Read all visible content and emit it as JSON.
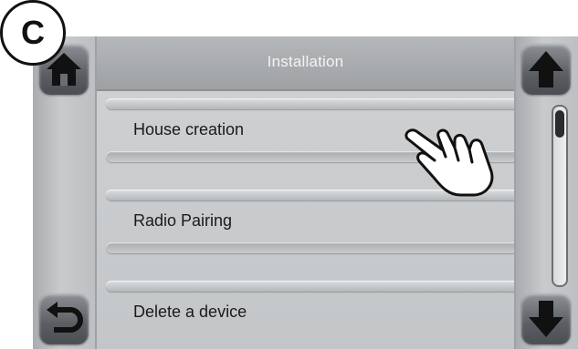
{
  "badge": {
    "label": "C"
  },
  "header": {
    "title": "Installation"
  },
  "menu": {
    "items": [
      {
        "label": "House creation"
      },
      {
        "label": "Radio Pairing"
      },
      {
        "label": "Delete a device"
      }
    ]
  },
  "scroll": {
    "position": 0.0
  },
  "icons": {
    "home": "home-icon",
    "back": "back-arrow-icon",
    "up": "arrow-up-icon",
    "down": "arrow-down-icon",
    "pointer": "pointing-hand-icon"
  }
}
